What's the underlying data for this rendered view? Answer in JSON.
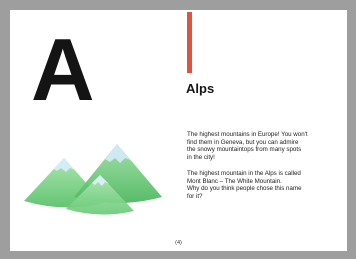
{
  "page": {
    "big_letter": "A",
    "heading": "Alps",
    "paragraph_1": [
      "The highest mountains in Europe! You won't",
      "find them in Geneva, but you can admire",
      "the snowy mountaintops from many spots",
      "in the city!"
    ],
    "paragraph_2": [
      "The highest mountain in the Alps is called",
      "Mont Blanc – The White Mountain.",
      "Why do you think people chose this name",
      "for it?"
    ],
    "page_number": "(4)",
    "illustration": "snowy-mountains-watercolor"
  },
  "colors": {
    "accent": "#e2533f",
    "letter": "#141414",
    "mountain_green": "#6fcf7d",
    "snow": "#cfe9f3"
  }
}
